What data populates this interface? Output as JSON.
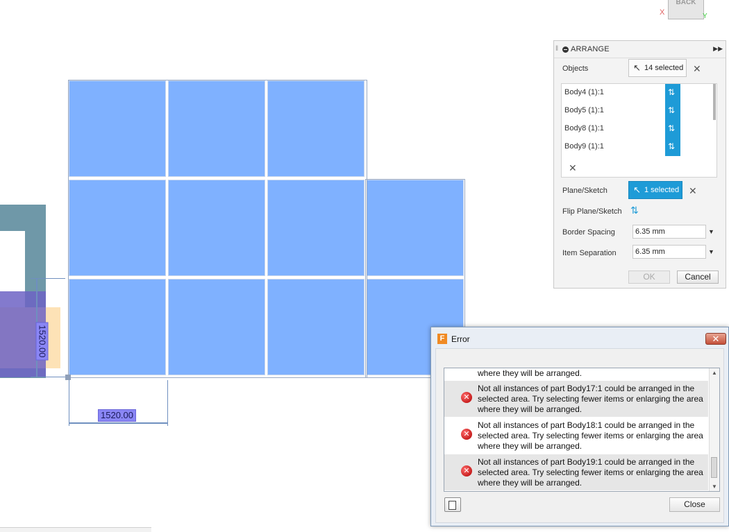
{
  "viewcube": {
    "face_label": "BACK",
    "axis_x": "X",
    "axis_y": "Y"
  },
  "dimensions": {
    "vertical": "1520.00",
    "horizontal": "1520.00"
  },
  "arrange": {
    "title": "ARRANGE",
    "objects_label": "Objects",
    "objects_selected": "14 selected",
    "bodies": [
      "Body4 (1):1",
      "Body5 (1):1",
      "Body8 (1):1",
      "Body9 (1):1"
    ],
    "plane_label": "Plane/Sketch",
    "plane_selected": "1 selected",
    "flip_label": "Flip Plane/Sketch",
    "border_spacing_label": "Border Spacing",
    "border_spacing_value": "6.35 mm",
    "item_separation_label": "Item Separation",
    "item_separation_value": "6.35 mm",
    "ok_label": "OK",
    "cancel_label": "Cancel"
  },
  "error_dialog": {
    "title": "Error",
    "close_label": "Close",
    "partial_message": "where they will be arranged.",
    "messages": [
      "Not all instances of part Body17:1 could be arranged in the selected area. Try selecting fewer items or enlarging the area where they will be arranged.",
      "Not all instances of part Body18:1 could be arranged in the selected area. Try selecting fewer items or enlarging the area where they will be arranged.",
      "Not all instances of part Body19:1 could be arranged in the selected area. Try selecting fewer items or enlarging the area where they will be arranged."
    ]
  },
  "colors": {
    "tile": "#7fb1ff",
    "accent": "#1e9bd7",
    "error": "#c00000"
  }
}
